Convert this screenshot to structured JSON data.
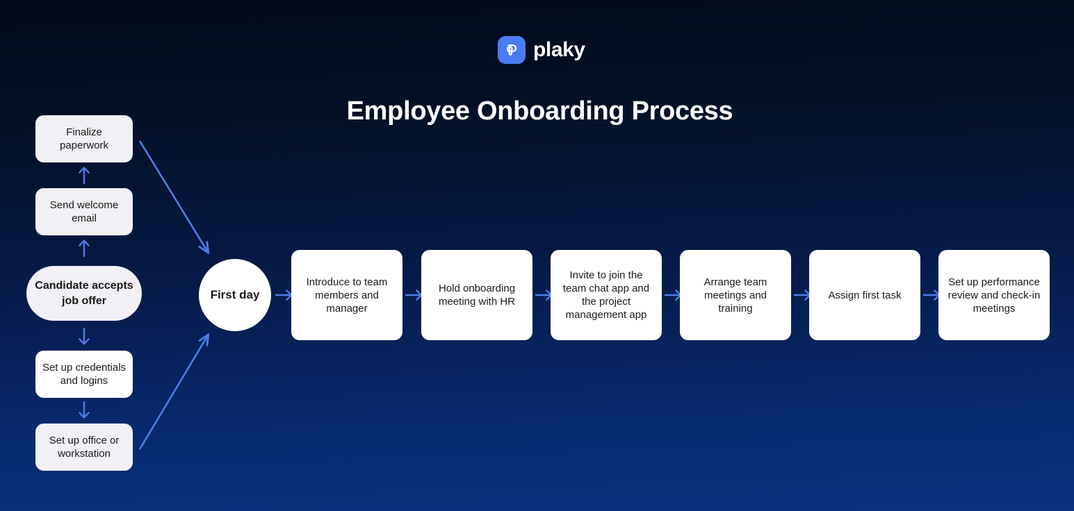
{
  "brand": {
    "logo_icon": "plaky-logo-icon",
    "name": "plaky",
    "accent_color": "#4a7cf3"
  },
  "header": {
    "title": "Employee Onboarding Process"
  },
  "theme": {
    "background_top": "#020a1c",
    "background_bottom": "#0a327f",
    "arrow_color": "#4a7fe8",
    "node_tint_fill": "#f0f0f5",
    "node_white_fill": "#ffffff",
    "node_text": "#1a1a1a"
  },
  "diagram": {
    "type": "flowchart",
    "pre_start_column": [
      {
        "id": "finalize-paperwork",
        "label": "Finalize paperwork",
        "shape": "rounded-rect",
        "fill": "#f0f0f5"
      },
      {
        "id": "send-welcome-email",
        "label": "Send welcome email",
        "shape": "rounded-rect",
        "fill": "#f0f0f5"
      }
    ],
    "start_node": {
      "id": "candidate-accepts-job-offer",
      "label": "Candidate accepts job offer",
      "shape": "pill",
      "fill": "#f0f0f5",
      "bold": true
    },
    "post_start_column": [
      {
        "id": "set-up-credentials-and-logins",
        "label": "Set up credentials and logins",
        "shape": "rounded-rect",
        "fill": "#ffffff"
      },
      {
        "id": "set-up-office-or-workstation",
        "label": "Set up office or workstation",
        "shape": "rounded-rect",
        "fill": "#f0f0f5"
      }
    ],
    "milestone_node": {
      "id": "first-day",
      "label": "First day",
      "shape": "circle",
      "fill": "#ffffff",
      "bold": true
    },
    "main_sequence": [
      {
        "id": "introduce-to-team",
        "label": "Introduce to team members and manager",
        "shape": "rounded-rect",
        "fill": "#ffffff"
      },
      {
        "id": "hold-onboarding-meeting",
        "label": "Hold onboarding meeting with HR",
        "shape": "rounded-rect",
        "fill": "#ffffff"
      },
      {
        "id": "invite-to-apps",
        "label": "Invite to join the team chat app and the project management app",
        "shape": "rounded-rect",
        "fill": "#ffffff"
      },
      {
        "id": "arrange-team-meetings",
        "label": "Arrange team meetings and training",
        "shape": "rounded-rect",
        "fill": "#ffffff"
      },
      {
        "id": "assign-first-task",
        "label": "Assign first task",
        "shape": "rounded-rect",
        "fill": "#ffffff"
      },
      {
        "id": "set-up-performance-review",
        "label": "Set up performance review and check-in meetings",
        "shape": "rounded-rect",
        "fill": "#ffffff"
      }
    ],
    "connectors": {
      "up_arrow_glyph": "↑",
      "down_arrow_glyph": "↓",
      "right_arrow_glyph": "→",
      "diagonal_down_right": "candidate pre-steps feed into First day",
      "diagonal_up_right": "candidate post-steps feed into First day"
    }
  }
}
